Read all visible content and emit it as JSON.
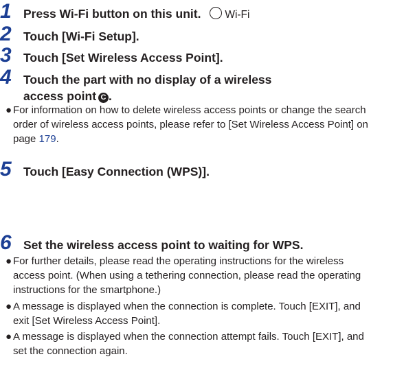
{
  "steps": [
    {
      "num": "1",
      "text": "Press Wi-Fi button on this unit.",
      "button_label": "Wi-Fi"
    },
    {
      "num": "2",
      "text": "Touch [Wi-Fi Setup]."
    },
    {
      "num": "3",
      "text": "Touch [Set Wireless Access Point]."
    },
    {
      "num": "4",
      "line1": "Touch the part with no display of a wireless",
      "line2": "access point",
      "marker": "C"
    },
    {
      "num": "5",
      "text": "Touch [Easy Connection (WPS)]."
    },
    {
      "num": "6",
      "text": "Set the wireless access point to waiting for WPS."
    }
  ],
  "step4_note": {
    "text": "For information on how to delete wireless access points or change the search order of wireless access points, please refer to [Set Wireless Access Point] on page ",
    "page_link": "179",
    "end": "."
  },
  "step6_notes": [
    "For further details, please read the operating instructions for the wireless access point. (When using a tethering connection, please read the operating instructions for the smartphone.)",
    "A message is displayed when the connection is complete. Touch [EXIT], and exit [Set Wireless Access Point].",
    "A message is displayed when the connection attempt fails. Touch [EXIT], and set the connection again."
  ],
  "colors": {
    "step_number": "#1c3f94",
    "link": "#1c3f94",
    "text": "#231f20"
  },
  "icons": {
    "wifi_button": "circle-button-icon",
    "marker": "circled-letter-c-icon"
  }
}
